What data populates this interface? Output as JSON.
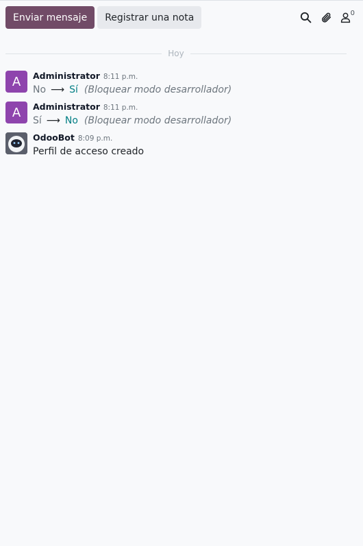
{
  "toolbar": {
    "send_message_label": "Enviar mensaje",
    "log_note_label": "Registrar una nota",
    "followers_count": "0",
    "icons": [
      "search-icon",
      "paperclip-icon",
      "user-icon"
    ]
  },
  "divider": {
    "label": "Hoy"
  },
  "messages": [
    {
      "avatar_letter": "A",
      "author": "Administrator",
      "time": "8:11 p.m.",
      "old_value": "No",
      "new_value": "Sí",
      "field": "(Bloquear modo desarrollador)"
    },
    {
      "avatar_letter": "A",
      "author": "Administrator",
      "time": "8:11 p.m.",
      "old_value": "Sí",
      "new_value": "No",
      "field": "(Bloquear modo desarrollador)"
    },
    {
      "author": "OdooBot",
      "time": "8:09 p.m.",
      "text": "Perfil de acceso creado"
    }
  ],
  "colors": {
    "primary": "#714b67",
    "avatar": "#8e44ad",
    "new_value": "#017e84"
  }
}
